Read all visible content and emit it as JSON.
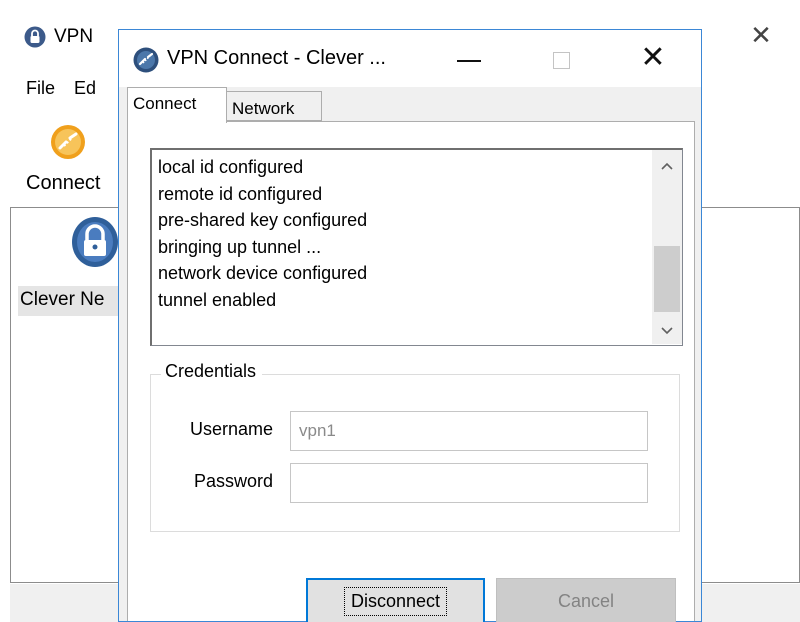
{
  "background_window": {
    "title": "VPN",
    "close_glyph": "✕",
    "menu": [
      "File",
      "Ed"
    ],
    "toolbar": {
      "connect_label": "Connect",
      "connect_icon": "connect-icon"
    },
    "site_list": [
      {
        "label": "Clever Ne",
        "icon": "lock-site-icon"
      }
    ]
  },
  "dialog": {
    "title": "VPN Connect - Clever ...",
    "close_glyph": "✕",
    "tabs": [
      {
        "label": "Connect",
        "active": true
      },
      {
        "label": "Network",
        "active": false
      }
    ],
    "log": {
      "lines": [
        "local id configured",
        "remote id configured",
        "pre-shared key configured",
        "bringing up tunnel ...",
        "network device configured",
        "tunnel enabled"
      ],
      "scroll_up_glyph": "⌃",
      "scroll_down_glyph": "⌄"
    },
    "credentials": {
      "legend": "Credentials",
      "username_label": "Username",
      "username_value": "vpn1",
      "password_label": "Password",
      "password_value": ""
    },
    "buttons": {
      "disconnect": "Disconnect",
      "cancel": "Cancel"
    }
  },
  "colors": {
    "accent_border": "#3b87d6",
    "focus_blue": "#0078d7",
    "dialog_bg": "#f0f0f0",
    "connect_icon_orange": "#f0a01c",
    "lock_icon_blue": "#2f5f9a"
  }
}
